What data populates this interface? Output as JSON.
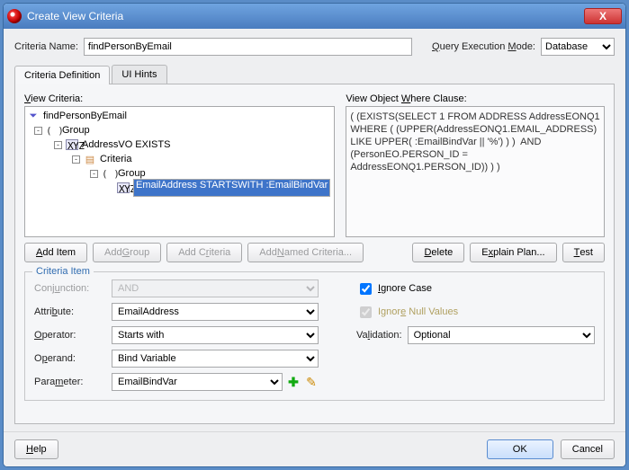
{
  "window": {
    "title": "Create View Criteria"
  },
  "top": {
    "nameLabel": "Criteria Name:",
    "nameValue": "findPersonByEmail",
    "modeLabel": "Query Execution Mode:",
    "modeValue": "Database"
  },
  "tabs": {
    "def": "Criteria Definition",
    "ui": "UI Hints"
  },
  "tree": {
    "label": "View Criteria:",
    "root": "findPersonByEmail",
    "group1": "Group",
    "addr": "AddressVO EXISTS",
    "criteria": "Criteria",
    "group2": "Group",
    "item": "EmailAddress STARTSWITH :EmailBindVar"
  },
  "where": {
    "label": "View Object Where Clause:",
    "text": "( (EXISTS(SELECT 1 FROM ADDRESS AddressEONQ1 WHERE ( (UPPER(AddressEONQ1.EMAIL_ADDRESS) LIKE UPPER( :EmailBindVar || '%') ) )  AND (PersonEO.PERSON_ID = AddressEONQ1.PERSON_ID)) ) )"
  },
  "buttons": {
    "addItem": "Add Item",
    "addGroup": "Add Group",
    "addCriteria": "Add Criteria",
    "addNamed": "Add Named Criteria...",
    "delete": "Delete",
    "explain": "Explain Plan...",
    "test": "Test"
  },
  "criteriaItem": {
    "legend": "Criteria Item",
    "conjunctionLabel": "Conjunction:",
    "conjunction": "AND",
    "attributeLabel": "Attribute:",
    "attribute": "EmailAddress",
    "operatorLabel": "Operator:",
    "operator": "Starts with",
    "operandLabel": "Operand:",
    "operand": "Bind Variable",
    "parameterLabel": "Parameter:",
    "parameter": "EmailBindVar",
    "ignoreCase": "Ignore Case",
    "ignoreNull": "Ignore Null Values",
    "validationLabel": "Validation:",
    "validation": "Optional"
  },
  "footer": {
    "help": "Help",
    "ok": "OK",
    "cancel": "Cancel"
  }
}
